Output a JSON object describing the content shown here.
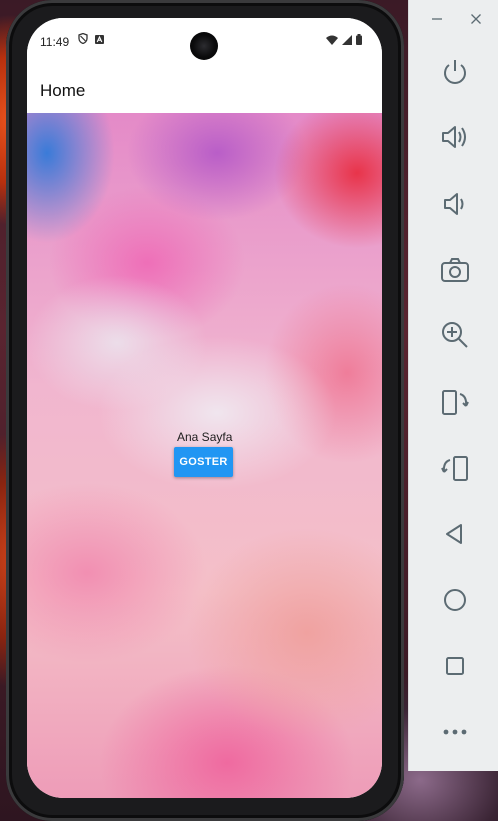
{
  "device": {
    "status_bar": {
      "time": "11:49",
      "left_icons": [
        "shield-icon",
        "notification-a-icon"
      ],
      "right_icons": [
        "wifi-icon",
        "signal-icon",
        "battery-icon"
      ]
    },
    "app_bar": {
      "title": "Home"
    },
    "main": {
      "label": "Ana Sayfa",
      "button_label": "GOSTER"
    },
    "colors": {
      "button": "#2196f3",
      "app_bar": "#ffffff"
    }
  },
  "emulator_toolbar": {
    "window_controls": [
      "minimize-icon",
      "close-icon"
    ],
    "buttons": [
      "power-icon",
      "volume-up-icon",
      "volume-down-icon",
      "camera-icon",
      "zoom-in-icon",
      "rotate-left-icon",
      "rotate-right-icon",
      "back-icon",
      "home-icon",
      "overview-icon",
      "more-icon"
    ]
  }
}
